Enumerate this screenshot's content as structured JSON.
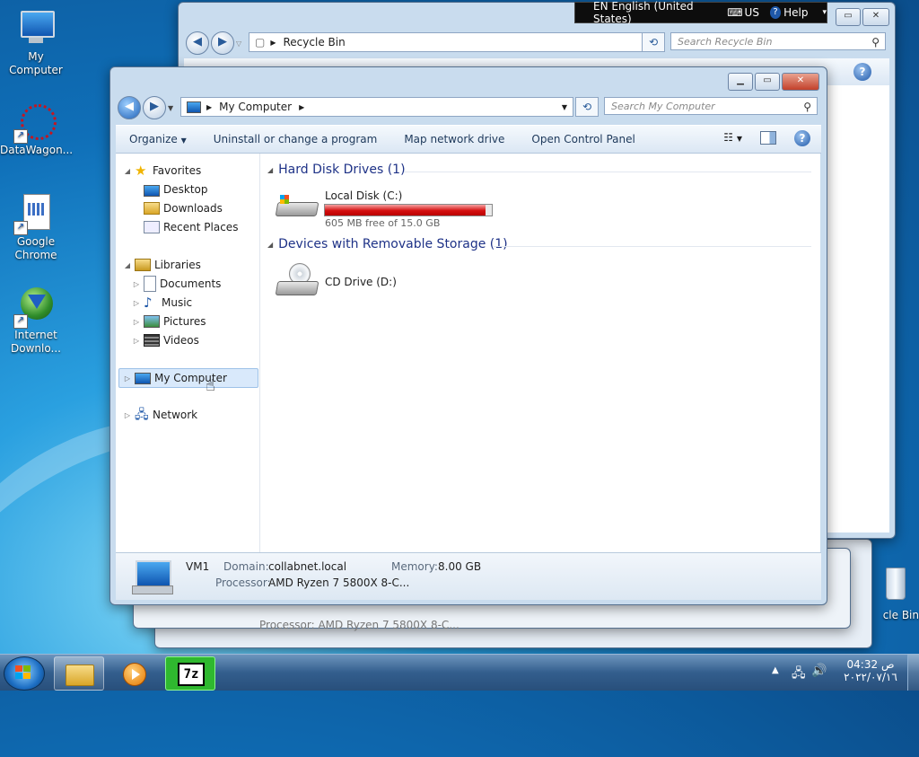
{
  "desktop": {
    "icons": [
      {
        "label": "My Computer"
      },
      {
        "label": "DataWagon..."
      },
      {
        "label": "Google Chrome"
      },
      {
        "label": "Internet Downlo..."
      },
      {
        "label": "cle Bin"
      }
    ]
  },
  "langbar": {
    "language": "EN English (United States)",
    "layout": "US",
    "help": "Help"
  },
  "back_window": {
    "address": "Recycle Bin",
    "search_placeholder": "Search Recycle Bin",
    "processor_ghost": "Processor: AMD Ryzen 7 5800X 8-C..."
  },
  "explorer": {
    "address": "My Computer",
    "search_placeholder": "Search My Computer",
    "toolbar": {
      "organize": "Organize",
      "uninstall": "Uninstall or change a program",
      "map_drive": "Map network drive",
      "control_panel": "Open Control Panel"
    },
    "nav": {
      "favorites": "Favorites",
      "desktop": "Desktop",
      "downloads": "Downloads",
      "recent": "Recent Places",
      "libraries": "Libraries",
      "documents": "Documents",
      "music": "Music",
      "pictures": "Pictures",
      "videos": "Videos",
      "computer": "My Computer",
      "network": "Network"
    },
    "groups": {
      "hdd_title": "Hard Disk Drives (1)",
      "removable_title": "Devices with Removable Storage (1)"
    },
    "drives": {
      "local_name": "Local Disk (C:)",
      "local_free": "605 MB free of 15.0 GB",
      "local_used_fraction": 0.96,
      "cd_name": "CD Drive (D:)"
    },
    "details": {
      "name": "VM1",
      "domain_label": "Domain:",
      "domain_value": "collabnet.local",
      "memory_label": "Memory:",
      "memory_value": "8.00 GB",
      "processor_label": "Processor:",
      "processor_value": "AMD Ryzen 7 5800X 8-C..."
    }
  },
  "taskbar": {
    "app_7z": "7z",
    "clock_time": "04:32 ص",
    "clock_date": "٢٠٢٢/٠٧/١٦"
  },
  "colors": {
    "accent": "#1e3287",
    "drive_bar_full": "#d50f0f"
  }
}
